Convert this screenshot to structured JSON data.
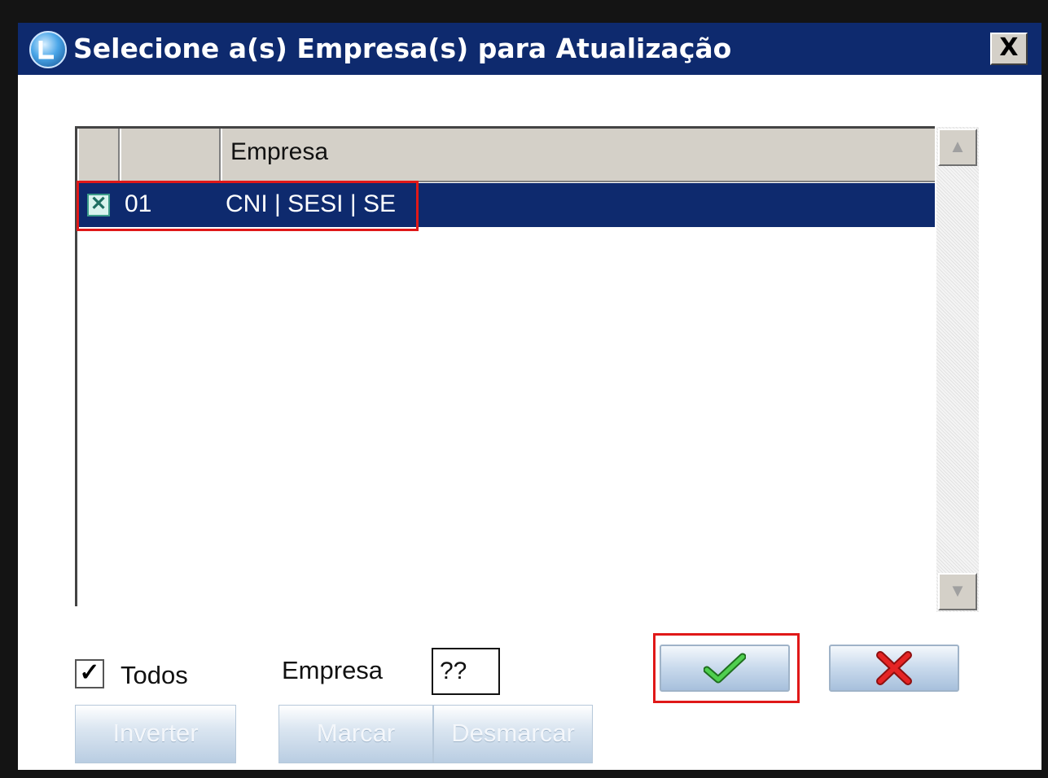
{
  "window": {
    "title": "Selecione a(s) Empresa(s) para Atualização",
    "icon": "app-globe-icon",
    "close_label": "X"
  },
  "grid": {
    "columns": [
      "",
      "",
      "Empresa"
    ],
    "rows": [
      {
        "checked": true,
        "code": "01",
        "name": "CNI | SESI | SE",
        "selected": true
      }
    ],
    "scroll_up_icon": "triangle-up-icon",
    "scroll_down_icon": "triangle-down-icon"
  },
  "controls": {
    "todos": {
      "label": "Todos",
      "checked": true
    },
    "empresa": {
      "label": "Empresa",
      "value": "??"
    },
    "ok_icon": "green-checkmark-icon",
    "cancel_icon": "red-x-icon",
    "inverter_label": "Inverter",
    "marcar_label": "Marcar",
    "desmarcar_label": "Desmarcar"
  },
  "colors": {
    "titlebar": "#0e2a6e",
    "selection": "#0e2a6e",
    "highlight": "#e01818",
    "ok_check": "#2ea32e",
    "cancel_x": "#d81c1c"
  }
}
